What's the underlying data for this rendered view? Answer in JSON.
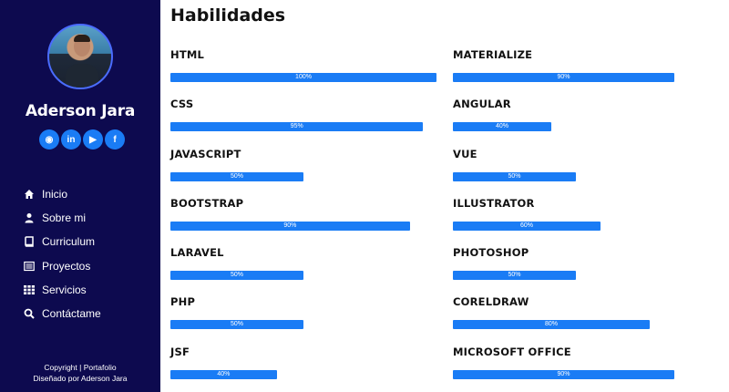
{
  "profile": {
    "name": "Aderson Jara"
  },
  "socials": [
    {
      "icon": "github-icon",
      "glyph": "◉"
    },
    {
      "icon": "linkedin-icon",
      "glyph": "in"
    },
    {
      "icon": "youtube-icon",
      "glyph": "▶"
    },
    {
      "icon": "facebook-icon",
      "glyph": "f"
    }
  ],
  "nav": [
    {
      "label": "Inicio",
      "icon": "home-icon"
    },
    {
      "label": "Sobre mi",
      "icon": "user-icon"
    },
    {
      "label": "Curriculum",
      "icon": "book-icon"
    },
    {
      "label": "Proyectos",
      "icon": "list-icon"
    },
    {
      "label": "Servicios",
      "icon": "grid-icon"
    },
    {
      "label": "Contáctame",
      "icon": "search-icon"
    }
  ],
  "footer": {
    "line1": "Copyright | Portafolio",
    "line2": "Diseñado por Aderson Jara"
  },
  "main": {
    "title": "Habilidades"
  },
  "skills_left": [
    {
      "name": "HTML",
      "percent": 100,
      "label": "100%"
    },
    {
      "name": "CSS",
      "percent": 95,
      "label": "95%"
    },
    {
      "name": "JAVASCRIPT",
      "percent": 50,
      "label": "50%"
    },
    {
      "name": "BOOTSTRAP",
      "percent": 90,
      "label": "90%"
    },
    {
      "name": "LARAVEL",
      "percent": 50,
      "label": "50%"
    },
    {
      "name": "PHP",
      "percent": 50,
      "label": "50%"
    },
    {
      "name": "JSF",
      "percent": 40,
      "label": "40%"
    }
  ],
  "skills_right": [
    {
      "name": "MATERIALIZE",
      "percent": 90,
      "label": "90%"
    },
    {
      "name": "ANGULAR",
      "percent": 40,
      "label": "40%"
    },
    {
      "name": "VUE",
      "percent": 50,
      "label": "50%"
    },
    {
      "name": "ILLUSTRATOR",
      "percent": 60,
      "label": "60%"
    },
    {
      "name": "PHOTOSHOP",
      "percent": 50,
      "label": "50%"
    },
    {
      "name": "CORELDRAW",
      "percent": 80,
      "label": "80%"
    },
    {
      "name": "MICROSOFT OFFICE",
      "percent": 90,
      "label": "90%"
    }
  ],
  "colors": {
    "sidebar_bg": "#0d0a4f",
    "accent": "#1a7cf5"
  }
}
